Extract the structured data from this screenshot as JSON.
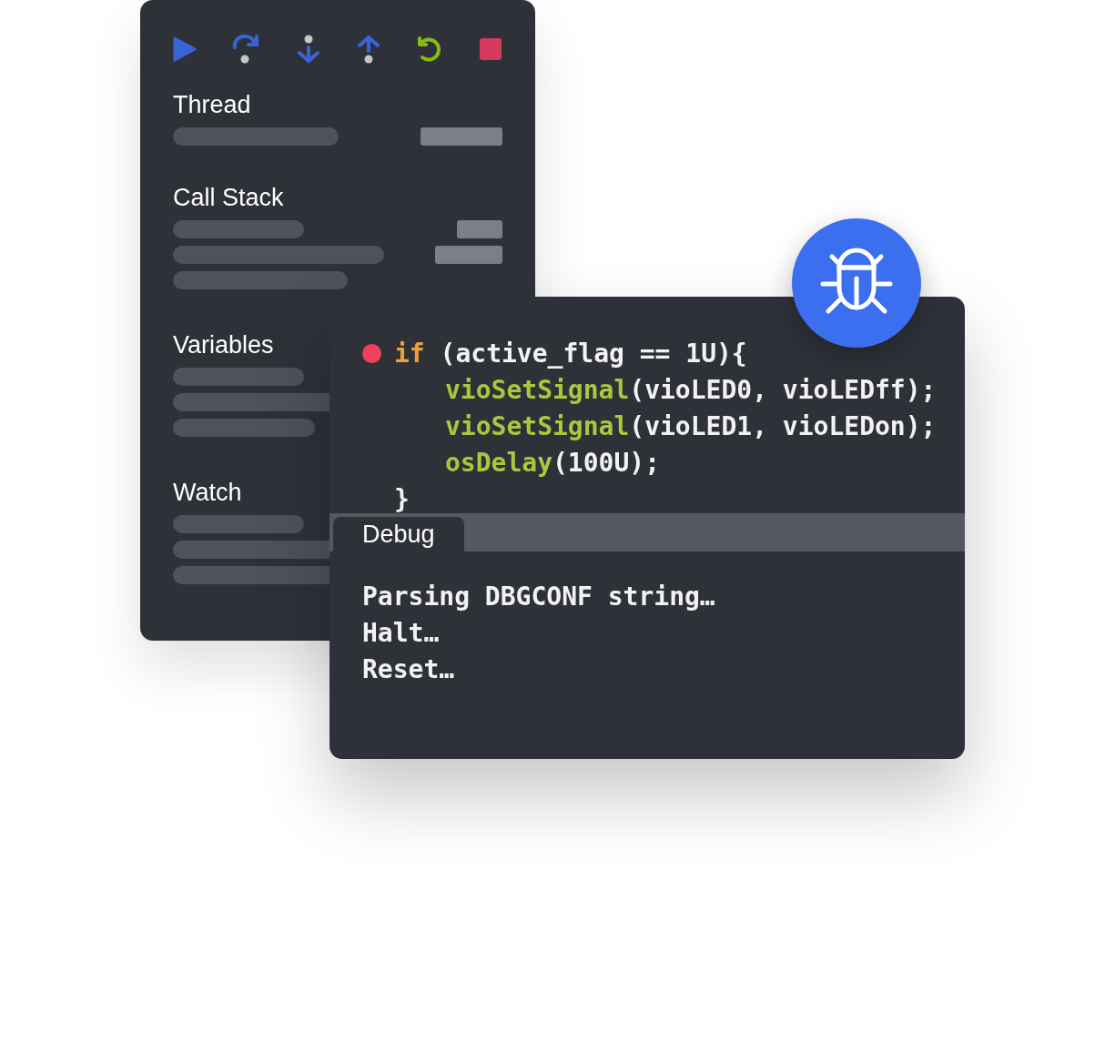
{
  "sidebar": {
    "sections": [
      {
        "title": "Thread"
      },
      {
        "title": "Call Stack"
      },
      {
        "title": "Variables"
      },
      {
        "title": "Watch"
      }
    ]
  },
  "editor": {
    "code": [
      {
        "breakpoint": true,
        "tokens": [
          {
            "kind": "keyword",
            "text": "if"
          },
          {
            "kind": "plain",
            "text": " (active_flag == 1U){"
          }
        ],
        "children": [
          {
            "breakpoint": false,
            "tokens": [
              {
                "kind": "function",
                "text": "vioSetSignal"
              },
              {
                "kind": "plain",
                "text": "(vioLED0, vioLEDff);"
              }
            ]
          },
          {
            "breakpoint": false,
            "tokens": [
              {
                "kind": "function",
                "text": "vioSetSignal"
              },
              {
                "kind": "plain",
                "text": "(vioLED1, vioLEDon);"
              }
            ]
          },
          {
            "breakpoint": false,
            "tokens": [
              {
                "kind": "function",
                "text": "osDelay"
              },
              {
                "kind": "plain",
                "text": "(100U);"
              }
            ]
          }
        ]
      },
      {
        "breakpoint": false,
        "tokens": [
          {
            "kind": "plain",
            "text": "}"
          }
        ]
      }
    ]
  },
  "panel": {
    "tabs": [
      {
        "label": "Debug",
        "selected": true
      }
    ],
    "output": [
      "Parsing DBGCONF string…",
      "Halt…",
      "Reset…"
    ]
  }
}
